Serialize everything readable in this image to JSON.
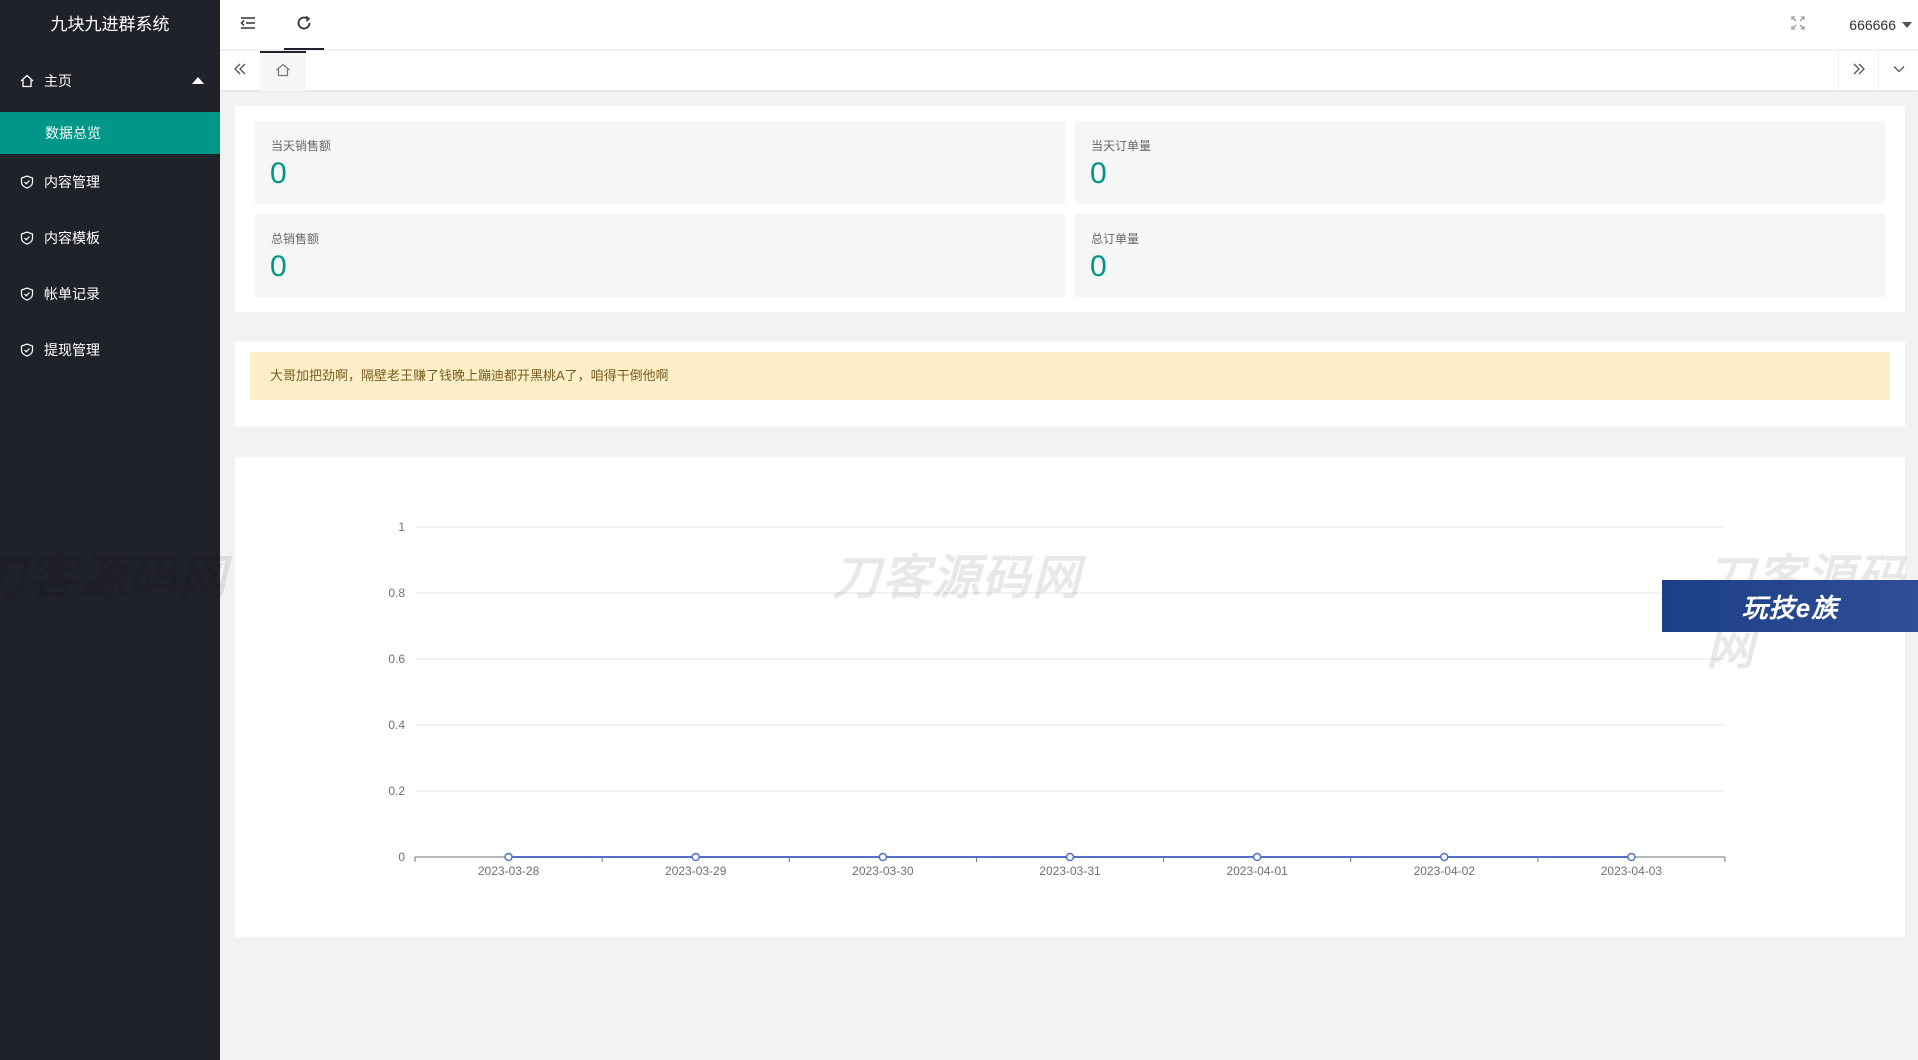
{
  "app": {
    "title": "九块九进群系统"
  },
  "sidebar": {
    "home": {
      "label": "主页",
      "icon": "home-icon",
      "children": [
        {
          "label": "数据总览"
        }
      ]
    },
    "items": [
      {
        "label": "内容管理",
        "icon": "shield-check-icon"
      },
      {
        "label": "内容模板",
        "icon": "shield-check-icon"
      },
      {
        "label": "帐单记录",
        "icon": "shield-check-icon"
      },
      {
        "label": "提现管理",
        "icon": "shield-check-icon"
      }
    ]
  },
  "header": {
    "user": "666666",
    "icons": [
      "menu-collapse-icon",
      "refresh-icon",
      "fullscreen-icon"
    ]
  },
  "tabs": {
    "icons": [
      "double-left-icon",
      "home-tab-icon",
      "double-right-icon",
      "chevron-down-icon"
    ]
  },
  "stats": {
    "today_sales_label": "当天销售额",
    "today_sales_value": "0",
    "today_orders_label": "当天订单量",
    "today_orders_value": "0",
    "total_sales_label": "总销售额",
    "total_sales_value": "0",
    "total_orders_label": "总订单量",
    "total_orders_value": "0"
  },
  "notice": {
    "text": "大哥加把劲啊，隔壁老王赚了钱晚上蹦迪都开黑桃A了，咱得干倒他啊"
  },
  "watermarks": {
    "text1": "刀客源码网",
    "text2": "刀客源码网",
    "text3": "刀客源码网",
    "badge": "玩技e族"
  },
  "colors": {
    "accent": "#009688",
    "sidebar_bg": "#20222a",
    "notice_bg": "#fdf0c9",
    "point": "#5470c6"
  },
  "chart_data": {
    "type": "line",
    "title": "",
    "xlabel": "",
    "ylabel": "",
    "x": [
      "2023-03-28",
      "2023-03-29",
      "2023-03-30",
      "2023-03-31",
      "2023-04-01",
      "2023-04-02",
      "2023-04-03"
    ],
    "series": [
      {
        "values": [
          0,
          0,
          0,
          0,
          0,
          0,
          0
        ]
      }
    ],
    "ylim": [
      0,
      1
    ],
    "yticks": [
      "0",
      "0.2",
      "0.4",
      "0.6",
      "0.8",
      "1"
    ],
    "grid": true
  }
}
